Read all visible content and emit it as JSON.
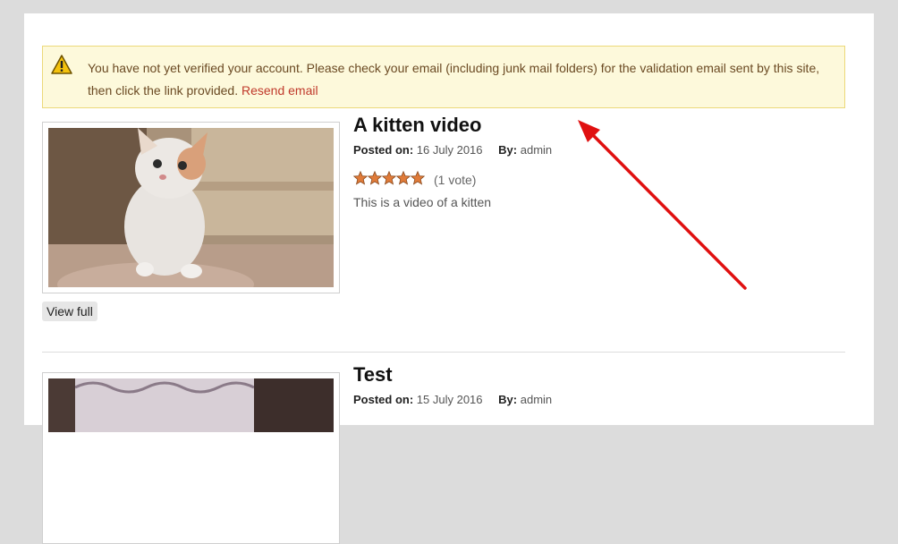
{
  "notice": {
    "message": "You have not yet verified your account. Please check your email (including junk mail folders) for the validation email sent by this site, then click the link provided.",
    "resend_link": "Resend email"
  },
  "posts": [
    {
      "title": "A kitten video",
      "posted_label": "Posted on:",
      "posted_date": "16 July 2016",
      "by_label": "By:",
      "author": "admin",
      "stars": 5,
      "votes": "(1 vote)",
      "description": "This is a video of a kitten",
      "view_button": "View full"
    },
    {
      "title": "Test",
      "posted_label": "Posted on:",
      "posted_date": "15 July 2016",
      "by_label": "By:",
      "author": "admin"
    }
  ],
  "colors": {
    "notice_bg": "#fdf9db",
    "notice_text": "#6b4a23",
    "link": "#c0392b",
    "arrow": "#e01010",
    "star": "#e07b39"
  }
}
